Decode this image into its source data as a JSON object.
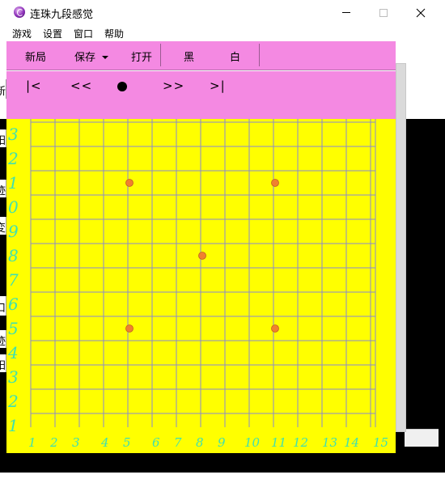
{
  "window": {
    "title": "连珠九段感觉",
    "icon": "app-logo-icon"
  },
  "menu": [
    "游戏",
    "设置",
    "窗口",
    "帮助"
  ],
  "toolbar": {
    "new_label": "新局",
    "save_label": "保存",
    "open_label": "打开",
    "black_label": "黑",
    "white_label": "白"
  },
  "navigation": {
    "first_label": "|<",
    "prev_label": "<<",
    "next_label": ">>",
    "last_label": ">|"
  },
  "left_fragments": [
    "新",
    "阳",
    "迹",
    "変",
    "口",
    "迹",
    "阳"
  ],
  "board": {
    "size": 15,
    "row_labels": [
      "3",
      "2",
      "1",
      "0",
      "9",
      "8",
      "7",
      "6",
      "5",
      "4",
      "3",
      "2",
      "1"
    ],
    "column_labels": [
      "1",
      "2",
      "3",
      "4",
      "5",
      "6",
      "7",
      "8",
      "9",
      "10",
      "11",
      "12",
      "13",
      "14",
      "15"
    ],
    "colors": {
      "board": "#ffff00",
      "grid_line": "#8a8ad0",
      "label": "#40e0b0",
      "star_point": "#f08030",
      "panel": "#f489e2"
    }
  }
}
